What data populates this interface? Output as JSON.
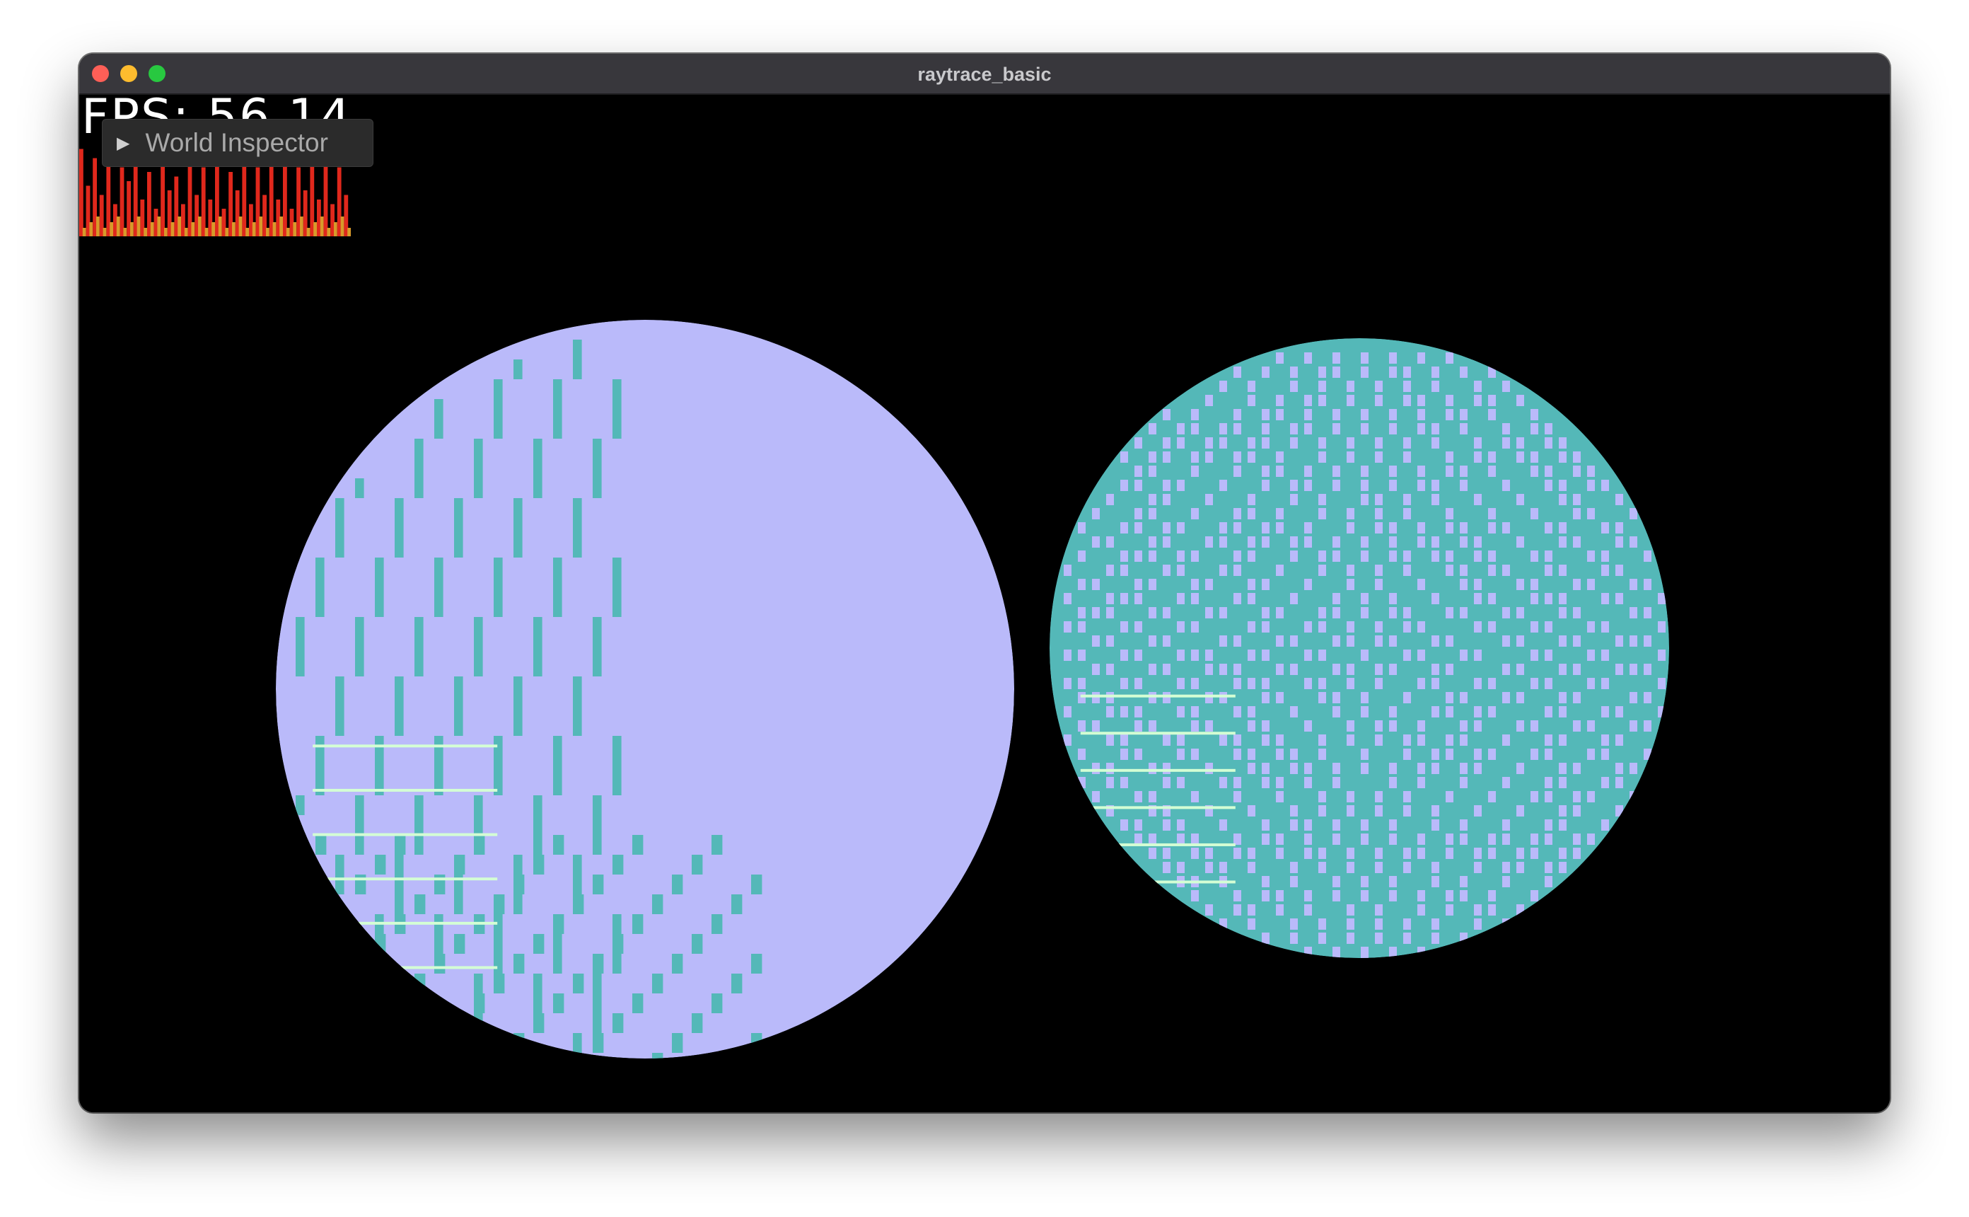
{
  "window": {
    "title": "raytrace_basic"
  },
  "overlay": {
    "fps_text": "FPS: 56.14",
    "inspector_label": "World Inspector",
    "inspector_arrow": "▶"
  },
  "frame_graph": {
    "samples": [
      0.95,
      0.55,
      0.85,
      0.45,
      0.9,
      0.35,
      0.75,
      0.6,
      0.8,
      0.4,
      0.7,
      0.3,
      0.85,
      0.5,
      0.65,
      0.35,
      0.8,
      0.45,
      0.75,
      0.4,
      0.85,
      0.3,
      0.7,
      0.5,
      0.8,
      0.35,
      0.75,
      0.45,
      0.85,
      0.4,
      0.8,
      0.3,
      0.75,
      0.5,
      0.8,
      0.4,
      0.85,
      0.35,
      0.75,
      0.45
    ],
    "bar_color": "#e0281c",
    "base_color": "#d89a2a"
  },
  "scene": {
    "colors": {
      "lavender": "#babafa",
      "teal": "#54b8b8",
      "highlight": "#d4ffd4"
    }
  }
}
